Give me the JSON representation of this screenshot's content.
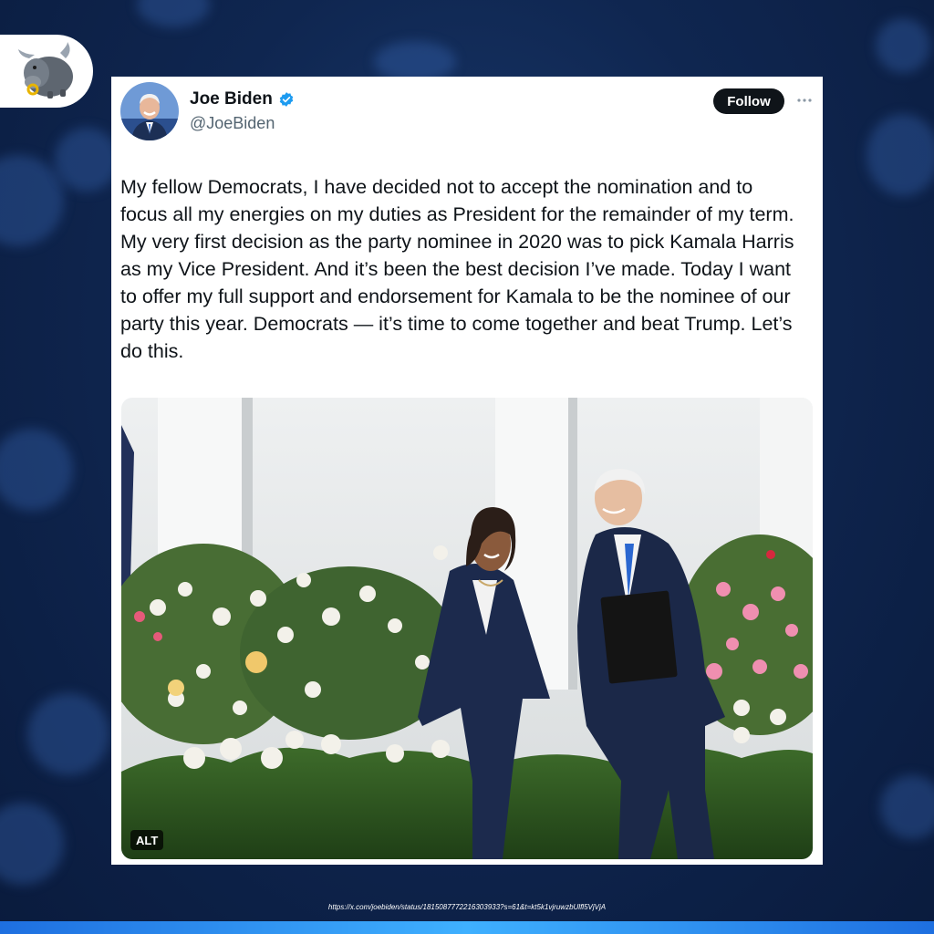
{
  "brand": {
    "logo_icon": "bull-icon",
    "accent_color": "#1e6fe0"
  },
  "post": {
    "author": {
      "display_name": "Joe Biden",
      "handle": "@JoeBiden",
      "verified_icon": "verified-badge-icon"
    },
    "follow_label": "Follow",
    "more_icon": "more-options-icon",
    "text": "My fellow Democrats, I have decided not to accept the nomination and to focus all my energies on my duties as President for the remainder of my term. My very first decision as the party nominee in 2020 was to pick Kamala Harris as my Vice President. And it’s been the best decision I’ve made. Today I want to offer my full support and endorsement for Kamala to be the nominee of our party this year. Democrats — it’s time to come together and beat Trump. Let’s do this.",
    "media": {
      "alt_label": "ALT"
    }
  },
  "source_url": "https://x.com/joebiden/status/1815087772216303933?s=61&t=kt5k1vjruwzbUlfl5VjVjA"
}
